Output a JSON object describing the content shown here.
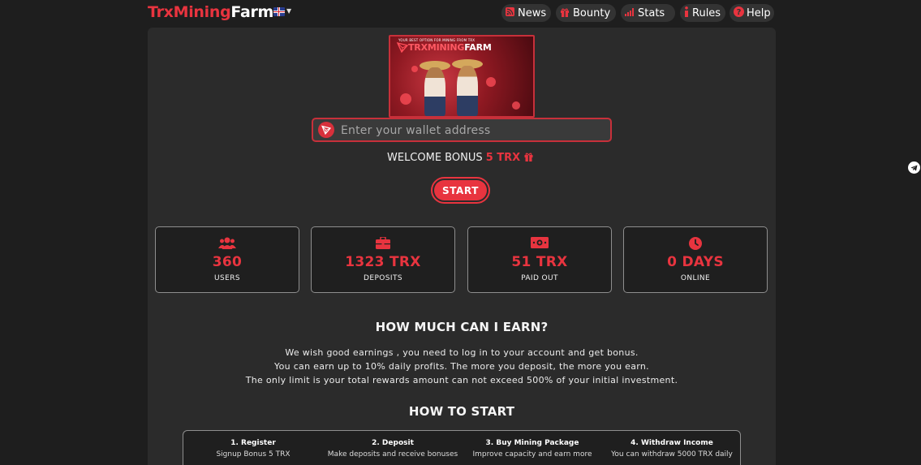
{
  "brand": {
    "part1": "TrxMining",
    "part2": "Farm"
  },
  "language": {
    "selected_icon": "uk-flag-icon"
  },
  "nav": [
    {
      "label": "News",
      "icon": "rss-icon"
    },
    {
      "label": "Bounty",
      "icon": "gift-icon"
    },
    {
      "label": "Stats",
      "icon": "signal-bars-icon"
    },
    {
      "label": "Rules",
      "icon": "info-icon"
    },
    {
      "label": "Help",
      "icon": "question-circle-icon"
    }
  ],
  "banner": {
    "tagline": "YOUR BEST OPTION FOR MINING FROM TRX",
    "title_part1": "TRXMINING",
    "title_part2": "FARM"
  },
  "wallet": {
    "placeholder": "Enter your wallet address",
    "value": ""
  },
  "welcome": {
    "text": "WELCOME BONUS ",
    "bonus": "5 TRX"
  },
  "start_label": "START",
  "stats": [
    {
      "value": "360",
      "label": "USERS",
      "icon": "users-icon"
    },
    {
      "value": "1323 TRX",
      "label": "DEPOSITS",
      "icon": "briefcase-icon"
    },
    {
      "value": "51 TRX",
      "label": "PAID OUT",
      "icon": "money-bill-icon"
    },
    {
      "value": "0 DAYS",
      "label": "ONLINE",
      "icon": "clock-icon"
    }
  ],
  "earn": {
    "heading": "HOW MUCH CAN I EARN?",
    "lines": [
      "We wish good earnings , you need to log in to your account and get bonus.",
      "You can earn up to 10% daily profits. The more you deposit, the more you earn.",
      "The only limit is your total rewards amount can not exceed 500% of your initial investment."
    ]
  },
  "how_to_start": {
    "heading": "HOW TO START",
    "steps": [
      {
        "title": "1. Register",
        "desc": "Signup Bonus 5 TRX"
      },
      {
        "title": "2. Deposit",
        "desc": "Make deposits and receive bonuses"
      },
      {
        "title": "3. Buy Mining Package",
        "desc": "Improve capacity and earn more"
      },
      {
        "title": "4. Withdraw Income",
        "desc": "You can withdraw 5000 TRX daily"
      }
    ]
  },
  "colors": {
    "accent": "#e8343f",
    "background": "#1e1e1e",
    "panel": "#2b2b2b"
  },
  "side_widget_icon": "telegram-icon"
}
